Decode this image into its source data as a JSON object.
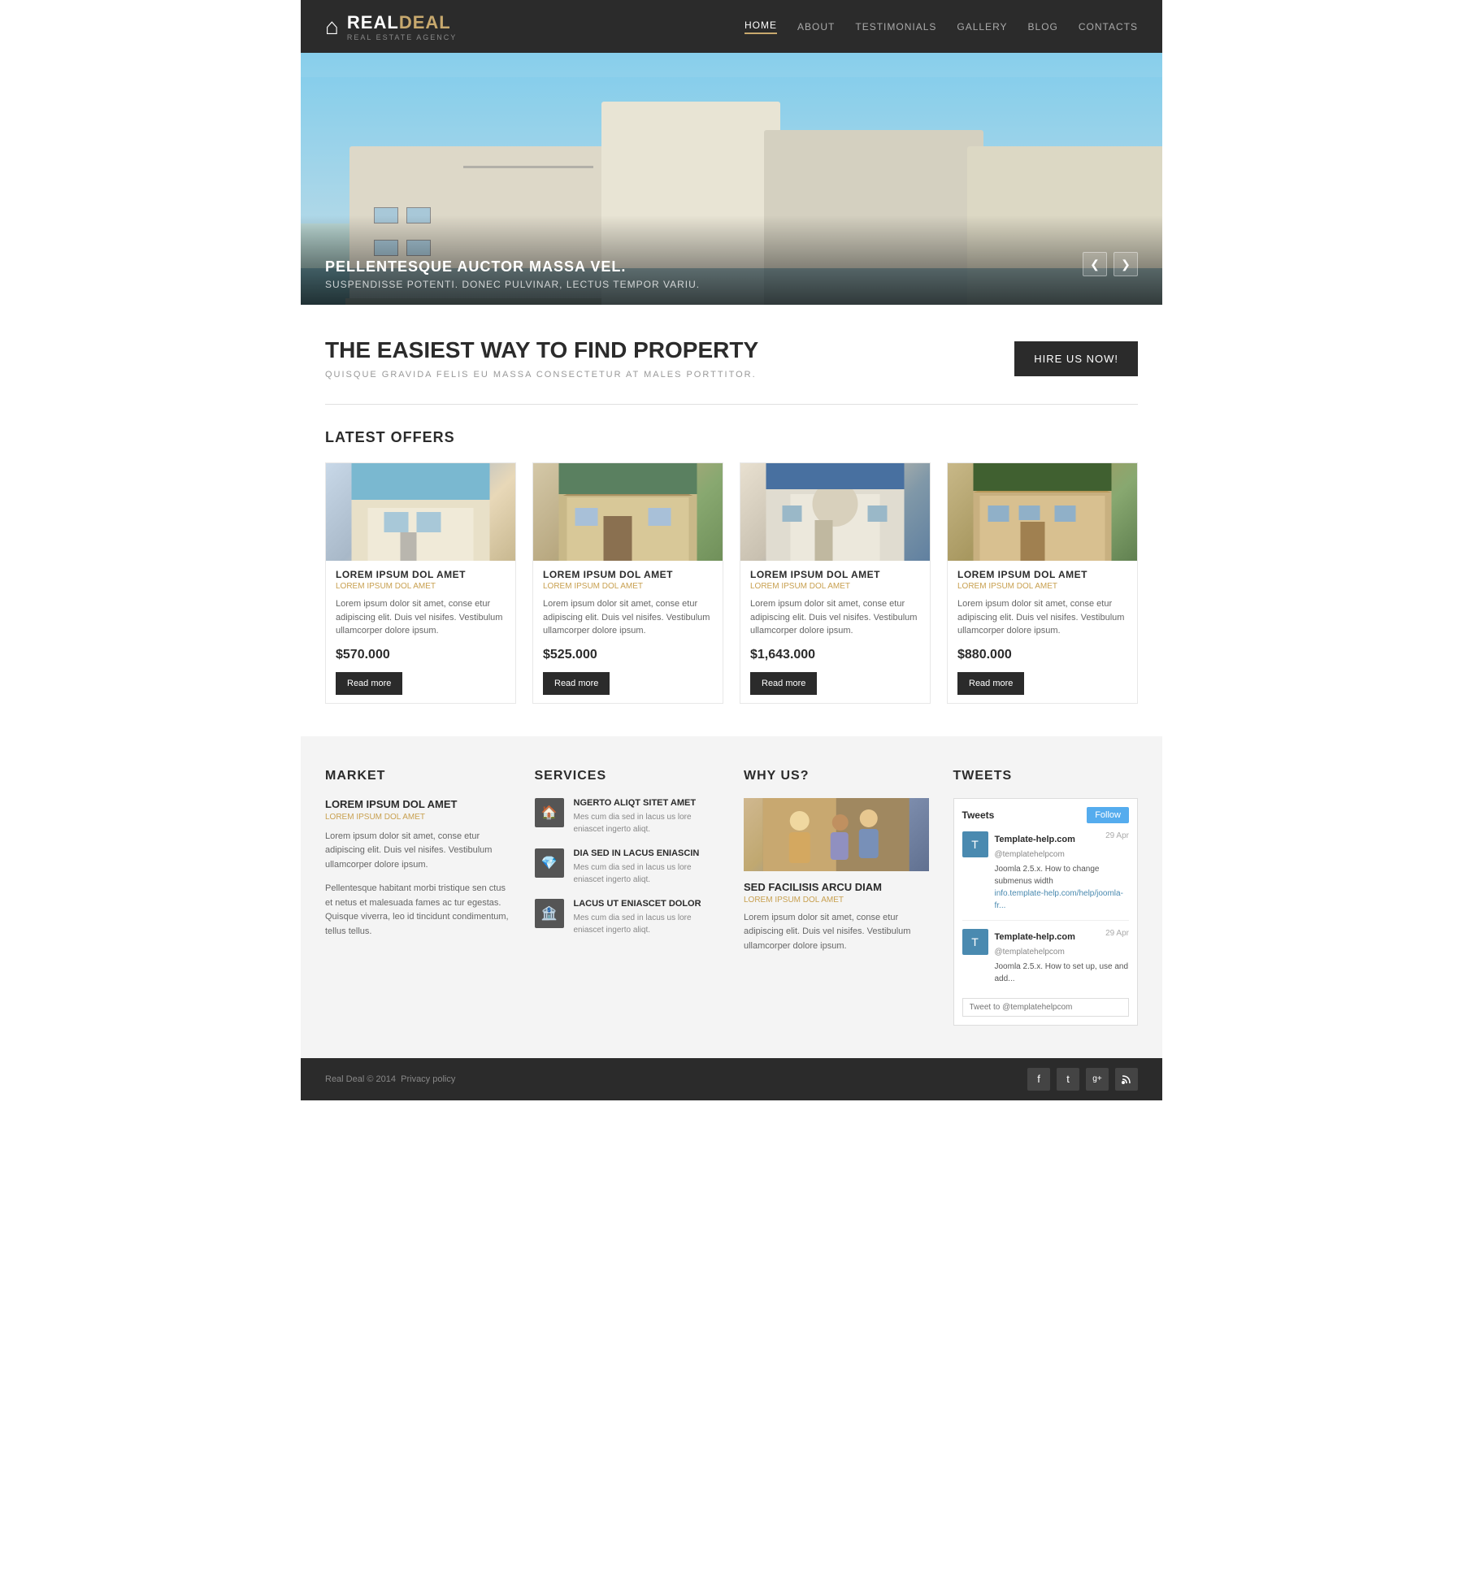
{
  "site": {
    "name_real": "REAL",
    "name_deal": "DEAL",
    "tagline": "REAL ESTATE AGENCY"
  },
  "nav": {
    "items": [
      {
        "label": "HOME",
        "active": true
      },
      {
        "label": "ABOUT",
        "active": false
      },
      {
        "label": "TESTIMONIALS",
        "active": false
      },
      {
        "label": "GALLERY",
        "active": false
      },
      {
        "label": "BLOG",
        "active": false
      },
      {
        "label": "CONTACTS",
        "active": false
      }
    ]
  },
  "hero": {
    "title": "PELLENTESQUE AUCTOR MASSA VEL.",
    "subtitle": "SUSPENDISSE POTENTI. DONEC PULVINAR, LECTUS TEMPOR VARIU.",
    "prev_label": "❮",
    "next_label": "❯"
  },
  "intro": {
    "heading": "THE EASIEST WAY TO FIND PROPERTY",
    "subtext": "QUISQUE GRAVIDA FELIS EU MASSA CONSECTETUR AT MALES PORTTITOR.",
    "hire_btn": "HIRE US NOW!"
  },
  "latest_offers": {
    "section_title": "LATEST OFFERS",
    "items": [
      {
        "title": "LOREM IPSUM DOL AMET",
        "subtitle": "LOREM IPSUM DOL AMET",
        "description": "Lorem ipsum dolor sit amet, conse etur adipiscing elit. Duis vel nisifes. Vestibulum ullamcorper dolore ipsum.",
        "price": "$570.000",
        "btn_label": "Read more"
      },
      {
        "title": "LOREM IPSUM DOL AMET",
        "subtitle": "LOREM IPSUM DOL AMET",
        "description": "Lorem ipsum dolor sit amet, conse etur adipiscing elit. Duis vel nisifes. Vestibulum ullamcorper dolore ipsum.",
        "price": "$525.000",
        "btn_label": "Read more"
      },
      {
        "title": "LOREM IPSUM DOL AMET",
        "subtitle": "LOREM IPSUM DOL AMET",
        "description": "Lorem ipsum dolor sit amet, conse etur adipiscing elit. Duis vel nisifes. Vestibulum ullamcorper dolore ipsum.",
        "price": "$1,643.000",
        "btn_label": "Read more"
      },
      {
        "title": "LOREM IPSUM DOL AMET",
        "subtitle": "LOREM IPSUM DOL AMET",
        "description": "Lorem ipsum dolor sit amet, conse etur adipiscing elit. Duis vel nisifes. Vestibulum ullamcorper dolore ipsum.",
        "price": "$880.000",
        "btn_label": "Read more"
      }
    ]
  },
  "market": {
    "section_title": "MARKET",
    "item_title": "LOREM IPSUM DOL AMET",
    "item_subtitle": "LOREM IPSUM DOL AMET",
    "desc1": "Lorem ipsum dolor sit amet, conse etur adipiscing elit. Duis vel nisifes. Vestibulum ullamcorper dolore ipsum.",
    "desc2": "Pellentesque habitant morbi tristique sen ctus et netus et malesuada fames ac tur egestas. Quisque viverra, leo id tincidunt condimentum, tellus tellus."
  },
  "services": {
    "section_title": "SERVICES",
    "items": [
      {
        "icon": "🏠",
        "title": "NGERTO ALIQT SITET AMET",
        "desc": "Mes cum dia sed in lacus us lore eniascet ingerto aliqt."
      },
      {
        "icon": "💎",
        "title": "DIA SED IN LACUS ENIASCIN",
        "desc": "Mes cum dia sed in lacus us lore eniascet ingerto aliqt."
      },
      {
        "icon": "🏦",
        "title": "LACUS UT ENIASCET DOLOR",
        "desc": "Mes cum dia sed in lacus us lore eniascet ingerto aliqt."
      }
    ]
  },
  "whyus": {
    "section_title": "WHY US?",
    "item_title": "SED FACILISIS ARCU DIAM",
    "item_subtitle": "LOREM IPSUM DOL AMET",
    "desc": "Lorem ipsum dolor sit amet, conse etur adipiscing elit. Duis vel nisifes. Vestibulum ullamcorper dolore ipsum."
  },
  "tweets": {
    "section_title": "TWEETS",
    "widget_label": "Tweets",
    "follow_btn": "Follow",
    "items": [
      {
        "name": "Template-help.com",
        "handle": "@templatehelpcom",
        "date": "29 Apr",
        "text": "Joomla 2.5.x. How to change submenus width",
        "link": "info.template-help.com/help/joomla-fr..."
      },
      {
        "name": "Template-help.com",
        "handle": "@templatehelpcom",
        "date": "29 Apr",
        "text": "Joomla 2.5.x. How to set up, use and add...",
        "link": ""
      }
    ],
    "input_placeholder": "Tweet to @templatehelpcom"
  },
  "footer": {
    "copyright": "Real Deal © 2014",
    "policy_link": "Privacy policy",
    "social": [
      {
        "icon": "f",
        "name": "facebook"
      },
      {
        "icon": "t",
        "name": "twitter"
      },
      {
        "icon": "g+",
        "name": "google-plus"
      },
      {
        "icon": "⊞",
        "name": "rss"
      }
    ]
  }
}
